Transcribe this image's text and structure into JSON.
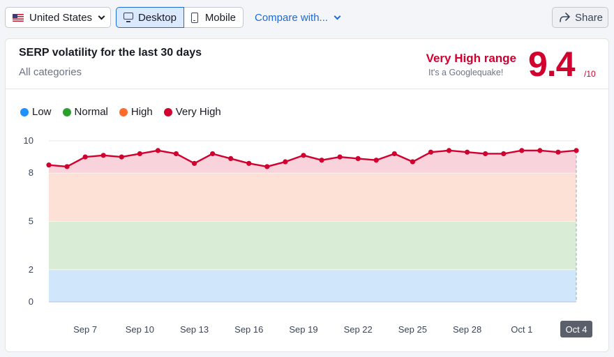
{
  "toolbar": {
    "country": "United States",
    "desktop_label": "Desktop",
    "mobile_label": "Mobile",
    "compare_label": "Compare with...",
    "share_label": "Share"
  },
  "card": {
    "title": "SERP volatility for the last 30 days",
    "subtitle": "All categories",
    "range_label": "Very High range",
    "range_sub": "It's a Googlequake!",
    "score": "9.4",
    "score_den": "/10"
  },
  "legend": [
    {
      "label": "Low",
      "color": "#1e90ff"
    },
    {
      "label": "Normal",
      "color": "#2ca02c"
    },
    {
      "label": "High",
      "color": "#ff6b2b"
    },
    {
      "label": "Very High",
      "color": "#d1002f"
    }
  ],
  "chart_data": {
    "type": "line",
    "bands": [
      {
        "name": "Low",
        "from": 0,
        "to": 2,
        "color": "#cfe6fb"
      },
      {
        "name": "Normal",
        "from": 2,
        "to": 5,
        "color": "#d9ecd5"
      },
      {
        "name": "High",
        "from": 5,
        "to": 8,
        "color": "#fde0d6"
      },
      {
        "name": "Very High",
        "from": 8,
        "to": 10,
        "color": "#f8d3dc"
      }
    ],
    "y_ticks": [
      0,
      2,
      5,
      8,
      10
    ],
    "ylim": [
      0,
      10
    ],
    "x_tick_labels": [
      "Sep 7",
      "Sep 10",
      "Sep 13",
      "Sep 16",
      "Sep 19",
      "Sep 22",
      "Sep 25",
      "Sep 28",
      "Oct 1",
      "Oct 4"
    ],
    "x_tick_indices": [
      2,
      5,
      8,
      11,
      14,
      17,
      20,
      23,
      26,
      29
    ],
    "highlighted_tick": "Oct 4",
    "series": [
      {
        "name": "SERP volatility",
        "color": "#d1002f",
        "values": [
          8.5,
          8.4,
          9.0,
          9.1,
          9.0,
          9.2,
          9.4,
          9.2,
          8.6,
          9.2,
          8.9,
          8.6,
          8.4,
          8.7,
          9.1,
          8.8,
          9.0,
          8.9,
          8.8,
          9.2,
          8.7,
          9.3,
          9.4,
          9.3,
          9.2,
          9.2,
          9.4,
          9.4,
          9.3,
          9.4
        ]
      }
    ]
  }
}
